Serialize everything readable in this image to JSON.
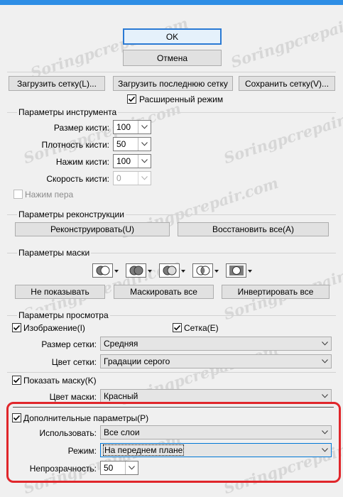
{
  "dialog": {
    "ok_label": "OK",
    "cancel_label": "Отмена",
    "load_mesh_label": "Загрузить сетку(L)...",
    "load_last_mesh_label": "Загрузить последнюю сетку",
    "save_mesh_label": "Сохранить сетку(V)...",
    "advanced_mode": {
      "label": "Расширенный режим",
      "checked": true
    }
  },
  "tool_options": {
    "title": "Параметры инструмента",
    "brush_size": {
      "label": "Размер кисти:",
      "value": "100"
    },
    "brush_density": {
      "label": "Плотность кисти:",
      "value": "50"
    },
    "brush_pressure": {
      "label": "Нажим кисти:",
      "value": "100"
    },
    "brush_rate": {
      "label": "Скорость кисти:",
      "value": "0"
    },
    "stylus_pressure": {
      "label": "Нажим пера",
      "checked": false
    }
  },
  "reconstruct_options": {
    "title": "Параметры реконструкции",
    "reconstruct_label": "Реконструировать(U)",
    "restore_all_label": "Восстановить все(A)"
  },
  "mask_options": {
    "title": "Параметры маски",
    "mode_icons": [
      "replace-selection-icon",
      "add-to-selection-icon",
      "subtract-from-selection-icon",
      "intersect-selection-icon",
      "invert-selection-icon"
    ],
    "none_label": "Не показывать",
    "mask_all_label": "Маскировать все",
    "invert_all_label": "Инвертировать все"
  },
  "view_options": {
    "title": "Параметры просмотра",
    "image": {
      "label": "Изображение(I)",
      "checked": true
    },
    "mesh": {
      "label": "Сетка(E)",
      "checked": true
    },
    "mesh_size": {
      "label": "Размер сетки:",
      "value": "Средняя"
    },
    "mesh_color": {
      "label": "Цвет сетки:",
      "value": "Градации серого"
    },
    "show_mask": {
      "label": "Показать маску(K)",
      "checked": true
    },
    "mask_color": {
      "label": "Цвет маски:",
      "value": "Красный"
    }
  },
  "extra_options": {
    "show_backdrop": {
      "label": "Дополнительные параметры(P)",
      "checked": true
    },
    "use": {
      "label": "Использовать:",
      "value": "Все слои"
    },
    "mode": {
      "label": "Режим:",
      "value": "На переднем плане"
    },
    "opacity": {
      "label": "Непрозрачность:",
      "value": "50"
    }
  },
  "colors": {
    "highlight": "#e0262b",
    "accent": "#2e8ee5"
  },
  "watermark": "Soringpcrepair.com"
}
